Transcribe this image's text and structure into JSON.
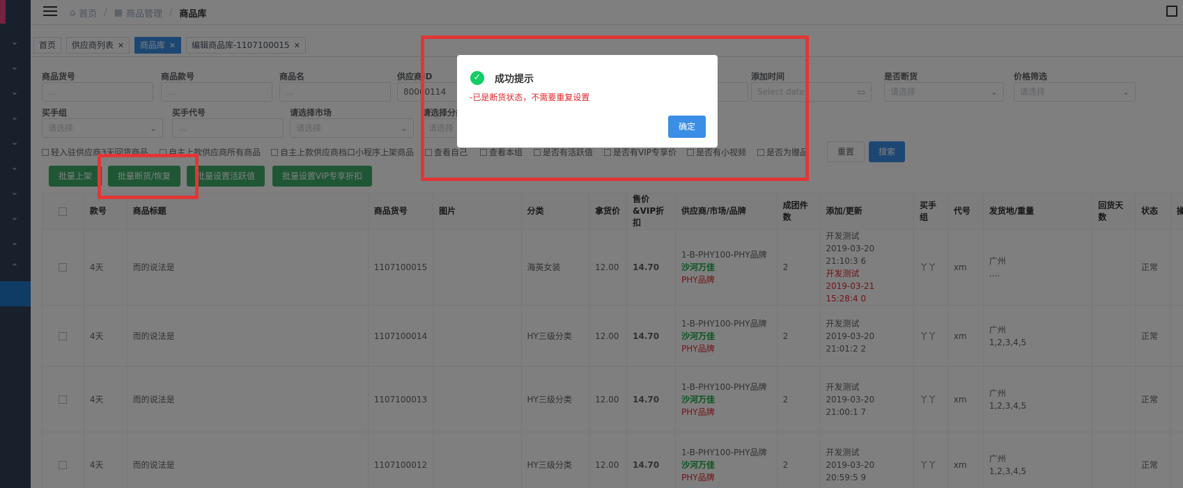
{
  "breadcrumb": {
    "home": "首页",
    "parent": "商品管理",
    "current": "商品库"
  },
  "tags": [
    {
      "label": "首页",
      "closable": false,
      "active": false
    },
    {
      "label": "供应商列表",
      "closable": true,
      "active": false
    },
    {
      "label": "商品库",
      "closable": true,
      "active": true
    },
    {
      "label": "编辑商品库-1107100015",
      "closable": true,
      "active": false
    }
  ],
  "filters": {
    "goods_no": {
      "label": "商品货号",
      "placeholder": "..."
    },
    "style_no": {
      "label": "商品款号",
      "placeholder": "..."
    },
    "goods_name": {
      "label": "商品名",
      "placeholder": "..."
    },
    "supplier_id": {
      "label": "供应商ID",
      "value": "80000114"
    },
    "add_time": {
      "label": "添加时间",
      "placeholder": "Select date"
    },
    "out_of_stock": {
      "label": "是否断货",
      "placeholder": "请选择"
    },
    "price_filter": {
      "label": "价格筛选",
      "placeholder": "请选择"
    },
    "buyer_group": {
      "label": "买手组",
      "placeholder": "请选择"
    },
    "buyer_code": {
      "label": "买手代号",
      "placeholder": "..."
    },
    "market": {
      "label": "请选择市场",
      "placeholder": "请选择"
    },
    "category": {
      "label": "请选择分类",
      "placeholder": "请选择"
    }
  },
  "checkboxes": [
    "轻入驻供应商3天回货商品",
    "自主上款供应商所有商品",
    "自主上款供应商档口小程序上架商品",
    "查看自己",
    "查看本组",
    "是否有活跃值",
    "是否有VIP专享价",
    "是否有小视频",
    "是否为赠品"
  ],
  "search_buttons": {
    "reset": "重置",
    "search": "搜索"
  },
  "batch_buttons": [
    "批量上架",
    "批量断货/恢复",
    "批量设置活跃值",
    "批量设置VIP专享折扣"
  ],
  "table": {
    "headers": [
      "款号",
      "商品标题",
      "商品货号",
      "图片",
      "分类",
      "拿货价",
      "售价&VIP折扣",
      "供应商/市场/品牌",
      "成团件数",
      "添加/更新",
      "买手组",
      "代号",
      "发货地/重量",
      "回货天数",
      "状态",
      "操"
    ],
    "rows": [
      {
        "style": "4天",
        "title": "而的说法是",
        "goods_no": "1107100015",
        "category": "海英女装",
        "cost": "12.00",
        "price": "14.70",
        "sup1": "1-B-PHY100-PHY品牌",
        "sup2": "沙河万佳",
        "sup3": "PHY品牌",
        "moq": "2",
        "add_by": "开发测试",
        "add_time": "2019-03-20 21:10:3 6",
        "upd_by": "开发测试",
        "upd_time": "2019-03-21 15:28:4 0",
        "group": "丫丫",
        "code": "xm",
        "ship": "广州",
        "weight": "....",
        "status": "正常"
      },
      {
        "style": "4天",
        "title": "而的说法是",
        "goods_no": "1107100014",
        "category": "HY三级分类",
        "cost": "12.00",
        "price": "14.70",
        "sup1": "1-B-PHY100-PHY品牌",
        "sup2": "沙河万佳",
        "sup3": "PHY品牌",
        "moq": "2",
        "add_by": "开发测试",
        "add_time": "2019-03-20 21:01:2 2",
        "group": "丫丫",
        "code": "xm",
        "ship": "广州",
        "weight": "1,2,3,4,5",
        "status": "正常"
      },
      {
        "style": "4天",
        "title": "而的说法是",
        "goods_no": "1107100013",
        "category": "HY三级分类",
        "cost": "12.00",
        "price": "14.70",
        "sup1": "1-B-PHY100-PHY品牌",
        "sup2": "沙河万佳",
        "sup3": "PHY品牌",
        "moq": "2",
        "add_by": "开发测试",
        "add_time": "2019-03-20 21:00:1 7",
        "group": "丫丫",
        "code": "xm",
        "ship": "广州",
        "weight": "1,2,3,4,5",
        "status": "正常"
      },
      {
        "style": "4天",
        "title": "而的说法是",
        "goods_no": "1107100012",
        "category": "HY三级分类",
        "cost": "12.00",
        "price": "14.70",
        "sup1": "1-B-PHY100-PHY品牌",
        "sup2": "沙河万佳",
        "sup3": "PHY品牌",
        "moq": "2",
        "add_by": "开发测试",
        "add_time": "2019-03-20 20:59:5 9",
        "group": "丫丫",
        "code": "xm",
        "ship": "广州",
        "weight": "1,2,3,4,5",
        "status": "正常"
      }
    ]
  },
  "dialog": {
    "title": "成功提示",
    "message": "-已是断货状态，不需要重复设置",
    "confirm": "确定"
  },
  "colors": {
    "primary": "#3a8ee6",
    "success": "#13ce66",
    "danger": "#e4262a",
    "batch": "#3fae6a",
    "highlight": "#e23636"
  }
}
